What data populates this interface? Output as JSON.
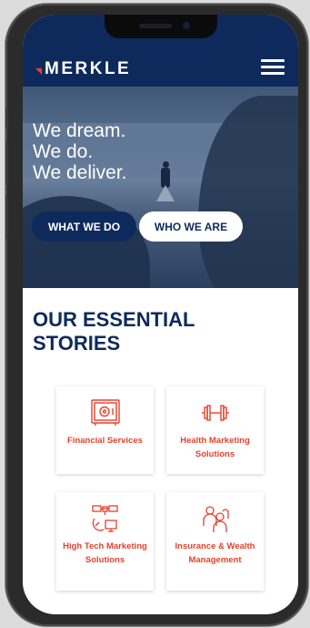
{
  "brand": {
    "name": "MERKLE",
    "accent": "#e8402b",
    "navy": "#0e2a5c"
  },
  "hero": {
    "lines": [
      "We dream.",
      "We do.",
      "We deliver."
    ],
    "primary_button": "WHAT WE DO",
    "secondary_button": "WHO WE ARE"
  },
  "section": {
    "title": "OUR ESSENTIAL STORIES"
  },
  "cards": [
    {
      "label": "Financial Services",
      "icon": "safe-icon"
    },
    {
      "label": "Health Marketing Solutions",
      "icon": "dumbbell-icon"
    },
    {
      "label": "High Tech Marketing Solutions",
      "icon": "satellite-icon"
    },
    {
      "label": "Insurance & Wealth Management",
      "icon": "family-icon"
    }
  ]
}
